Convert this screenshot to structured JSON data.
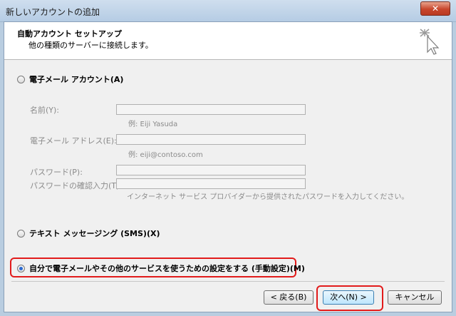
{
  "window": {
    "title": "新しいアカウントの追加",
    "close_glyph": "✕"
  },
  "header": {
    "title": "自動アカウント セットアップ",
    "subtitle": "他の種類のサーバーに接続します。",
    "icon": "wizard-cursor-icon"
  },
  "options": {
    "email_account": "電子メール アカウント(A)",
    "text_messaging": "テキスト メッセージング (SMS)(X)",
    "manual_setup": "自分で電子メールやその他のサービスを使うための設定をする (手動設定)(M)",
    "selected": "manual_setup"
  },
  "fields": {
    "name_label": "名前(Y):",
    "name_hint": "例: Eiji Yasuda",
    "email_label": "電子メール アドレス(E):",
    "email_hint": "例: eiji@contoso.com",
    "password_label": "パスワード(P):",
    "password_confirm_label": "パスワードの確認入力(T):",
    "password_hint": "インターネット サービス プロバイダーから提供されたパスワードを入力してください。"
  },
  "buttons": {
    "back": "< 戻る(B)",
    "next": "次へ(N) >",
    "cancel": "キャンセル"
  },
  "colors": {
    "highlight": "#e21b1b",
    "accent": "#2b6bd1"
  }
}
